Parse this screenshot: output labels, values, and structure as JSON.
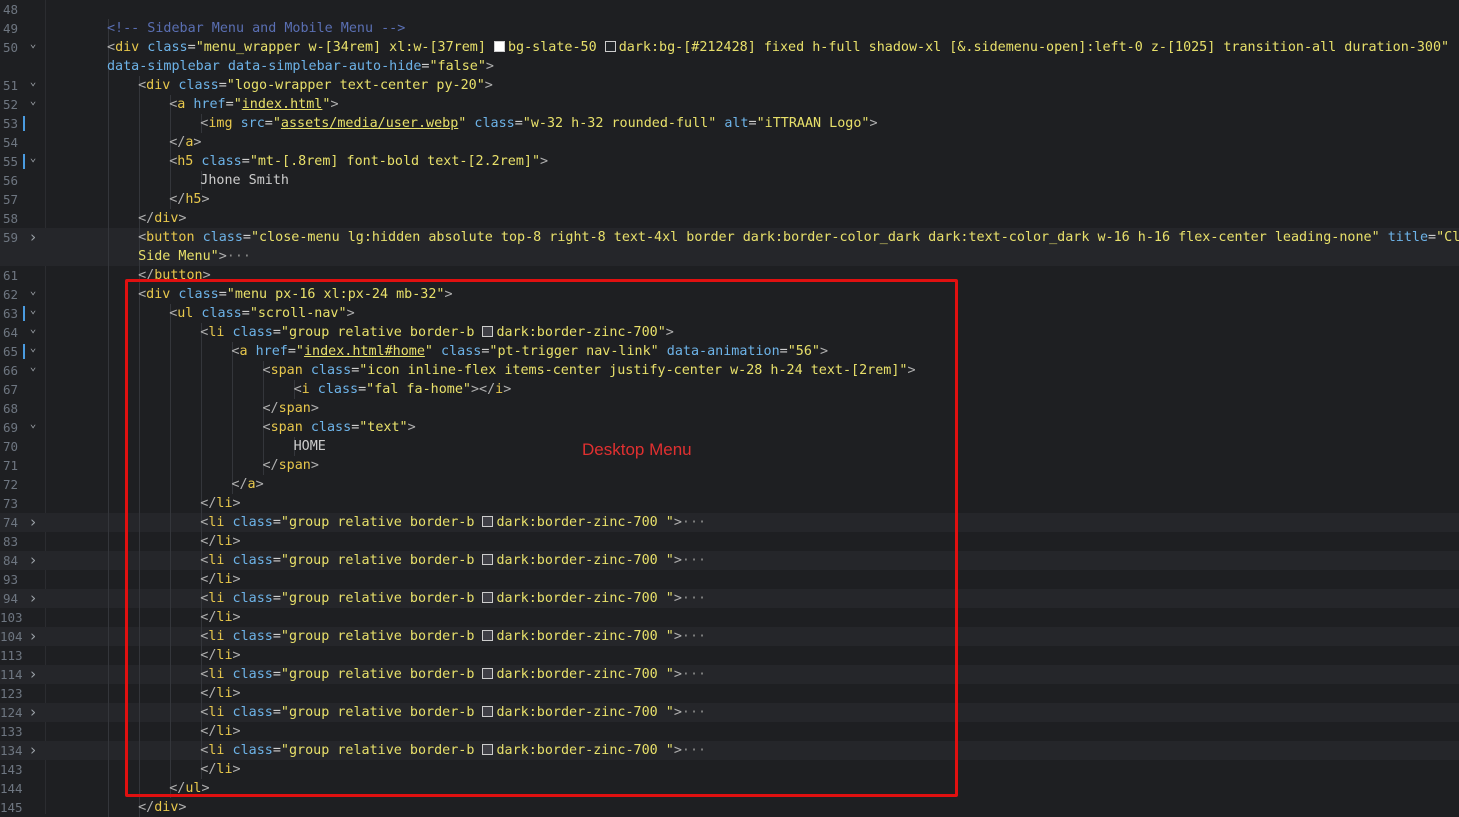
{
  "annotation": {
    "label": "Desktop Menu",
    "box_color": "#e01010"
  },
  "lines": [
    {
      "n": "48",
      "fold": "",
      "indent": 0,
      "segs": []
    },
    {
      "n": "49",
      "fold": "",
      "indent": 2,
      "segs": [
        [
          "c-cmt",
          "<!-- Sidebar Menu and Mobile Menu -->"
        ]
      ]
    },
    {
      "n": "50",
      "fold": "open",
      "indent": 2,
      "segs": [
        [
          "c-br",
          "<"
        ],
        [
          "c-tag",
          "div"
        ],
        [
          "c-attr",
          " class"
        ],
        [
          "c-eq",
          "="
        ],
        [
          "c-str",
          "\"menu_wrapper w-[34rem] xl:w-[37rem] "
        ],
        [
          "swatch",
          "#ffffff"
        ],
        [
          "c-str",
          "bg-slate-50 "
        ],
        [
          "swatch",
          "#212428"
        ],
        [
          "c-str",
          "dark:bg-[#212428] fixed h-full shadow-xl [&.sidemenu-open]:left-0 z-[1025] transition-all duration-300\""
        ]
      ]
    },
    {
      "n": "",
      "fold": "",
      "indent": 2,
      "segs": [
        [
          "c-attr",
          "data-simplebar data-simplebar-auto-hide"
        ],
        [
          "c-eq",
          "="
        ],
        [
          "c-str",
          "\"false\""
        ],
        [
          "c-br",
          ">"
        ]
      ]
    },
    {
      "n": "51",
      "fold": "open",
      "indent": 3,
      "segs": [
        [
          "c-br",
          "<"
        ],
        [
          "c-tag",
          "div"
        ],
        [
          "c-attr",
          " class"
        ],
        [
          "c-eq",
          "="
        ],
        [
          "c-str",
          "\"logo-wrapper text-center py-20\""
        ],
        [
          "c-br",
          ">"
        ]
      ]
    },
    {
      "n": "52",
      "fold": "open",
      "indent": 4,
      "segs": [
        [
          "c-br",
          "<"
        ],
        [
          "c-tag",
          "a"
        ],
        [
          "c-attr",
          " href"
        ],
        [
          "c-eq",
          "="
        ],
        [
          "c-str",
          "\""
        ],
        [
          "c-link",
          "index.html"
        ],
        [
          "c-str",
          "\""
        ],
        [
          "c-br",
          ">"
        ]
      ]
    },
    {
      "n": "53",
      "fold": "",
      "mod": true,
      "indent": 5,
      "segs": [
        [
          "c-br",
          "<"
        ],
        [
          "c-tag",
          "img"
        ],
        [
          "c-attr",
          " src"
        ],
        [
          "c-eq",
          "="
        ],
        [
          "c-str",
          "\""
        ],
        [
          "c-link",
          "assets/media/user.webp"
        ],
        [
          "c-str",
          "\""
        ],
        [
          "c-attr",
          " class"
        ],
        [
          "c-eq",
          "="
        ],
        [
          "c-str",
          "\"w-32 h-32 rounded-full\""
        ],
        [
          "c-attr",
          " alt"
        ],
        [
          "c-eq",
          "="
        ],
        [
          "c-str",
          "\"iTTRAAN Logo\""
        ],
        [
          "c-br",
          ">"
        ]
      ]
    },
    {
      "n": "54",
      "fold": "",
      "indent": 4,
      "segs": [
        [
          "c-br",
          "</"
        ],
        [
          "c-tag",
          "a"
        ],
        [
          "c-br",
          ">"
        ]
      ]
    },
    {
      "n": "55",
      "fold": "open",
      "mod": true,
      "indent": 4,
      "segs": [
        [
          "c-br",
          "<"
        ],
        [
          "c-tag",
          "h5"
        ],
        [
          "c-attr",
          " class"
        ],
        [
          "c-eq",
          "="
        ],
        [
          "c-str",
          "\"mt-[.8rem] font-bold text-[2.2rem]\""
        ],
        [
          "c-br",
          ">"
        ]
      ]
    },
    {
      "n": "56",
      "fold": "",
      "indent": 5,
      "segs": [
        [
          "c-txt",
          "Jhone Smith"
        ]
      ]
    },
    {
      "n": "57",
      "fold": "",
      "indent": 4,
      "segs": [
        [
          "c-br",
          "</"
        ],
        [
          "c-tag",
          "h5"
        ],
        [
          "c-br",
          ">"
        ]
      ]
    },
    {
      "n": "58",
      "fold": "",
      "indent": 3,
      "segs": [
        [
          "c-br",
          "</"
        ],
        [
          "c-tag",
          "div"
        ],
        [
          "c-br",
          ">"
        ]
      ]
    },
    {
      "n": "59",
      "fold": "closed",
      "hl": true,
      "indent": 3,
      "segs": [
        [
          "c-br",
          "<"
        ],
        [
          "c-tag",
          "button"
        ],
        [
          "c-attr",
          " class"
        ],
        [
          "c-eq",
          "="
        ],
        [
          "c-str",
          "\"close-menu lg:hidden absolute top-8 right-8 text-4xl border dark:border-color_dark dark:text-color_dark w-16 h-16 flex-center leading-none\""
        ],
        [
          "c-attr",
          " title"
        ],
        [
          "c-eq",
          "="
        ],
        [
          "c-str",
          "\"Close"
        ]
      ]
    },
    {
      "n": "",
      "fold": "",
      "hl": true,
      "indent": 3,
      "segs": [
        [
          "c-str",
          "Side Menu\""
        ],
        [
          "c-br",
          ">"
        ],
        [
          "c-ell",
          "···"
        ]
      ]
    },
    {
      "n": "61",
      "fold": "",
      "indent": 3,
      "segs": [
        [
          "c-br",
          "</"
        ],
        [
          "c-tag",
          "button"
        ],
        [
          "c-br",
          ">"
        ]
      ]
    },
    {
      "n": "62",
      "fold": "open",
      "indent": 3,
      "segs": [
        [
          "c-br",
          "<"
        ],
        [
          "c-tag",
          "div"
        ],
        [
          "c-attr",
          " class"
        ],
        [
          "c-eq",
          "="
        ],
        [
          "c-str",
          "\"menu px-16 xl:px-24 mb-32\""
        ],
        [
          "c-br",
          ">"
        ]
      ]
    },
    {
      "n": "63",
      "fold": "open",
      "mod": true,
      "indent": 4,
      "segs": [
        [
          "c-br",
          "<"
        ],
        [
          "c-tag",
          "ul"
        ],
        [
          "c-attr",
          " class"
        ],
        [
          "c-eq",
          "="
        ],
        [
          "c-str",
          "\"scroll-nav\""
        ],
        [
          "c-br",
          ">"
        ]
      ]
    },
    {
      "n": "64",
      "fold": "open",
      "indent": 5,
      "segs": [
        [
          "c-br",
          "<"
        ],
        [
          "c-tag",
          "li"
        ],
        [
          "c-attr",
          " class"
        ],
        [
          "c-eq",
          "="
        ],
        [
          "c-str",
          "\"group relative border-b "
        ],
        [
          "swatch",
          "#3f3f46"
        ],
        [
          "c-str",
          "dark:border-zinc-700\""
        ],
        [
          "c-br",
          ">"
        ]
      ]
    },
    {
      "n": "65",
      "fold": "open",
      "mod": true,
      "indent": 6,
      "segs": [
        [
          "c-br",
          "<"
        ],
        [
          "c-tag",
          "a"
        ],
        [
          "c-attr",
          " href"
        ],
        [
          "c-eq",
          "="
        ],
        [
          "c-str",
          "\""
        ],
        [
          "c-link",
          "index.html#home"
        ],
        [
          "c-str",
          "\""
        ],
        [
          "c-attr",
          " class"
        ],
        [
          "c-eq",
          "="
        ],
        [
          "c-str",
          "\"pt-trigger nav-link\""
        ],
        [
          "c-attr",
          " data-animation"
        ],
        [
          "c-eq",
          "="
        ],
        [
          "c-str",
          "\"56\""
        ],
        [
          "c-br",
          ">"
        ]
      ]
    },
    {
      "n": "66",
      "fold": "open",
      "indent": 7,
      "segs": [
        [
          "c-br",
          "<"
        ],
        [
          "c-tag",
          "span"
        ],
        [
          "c-attr",
          " class"
        ],
        [
          "c-eq",
          "="
        ],
        [
          "c-str",
          "\"icon inline-flex items-center justify-center w-28 h-24 text-[2rem]\""
        ],
        [
          "c-br",
          ">"
        ]
      ]
    },
    {
      "n": "67",
      "fold": "",
      "indent": 8,
      "segs": [
        [
          "c-br",
          "<"
        ],
        [
          "c-tag",
          "i"
        ],
        [
          "c-attr",
          " class"
        ],
        [
          "c-eq",
          "="
        ],
        [
          "c-str",
          "\"fal fa-home\""
        ],
        [
          "c-br",
          "></"
        ],
        [
          "c-tag",
          "i"
        ],
        [
          "c-br",
          ">"
        ]
      ]
    },
    {
      "n": "68",
      "fold": "",
      "indent": 7,
      "segs": [
        [
          "c-br",
          "</"
        ],
        [
          "c-tag",
          "span"
        ],
        [
          "c-br",
          ">"
        ]
      ]
    },
    {
      "n": "69",
      "fold": "open",
      "indent": 7,
      "segs": [
        [
          "c-br",
          "<"
        ],
        [
          "c-tag",
          "span"
        ],
        [
          "c-attr",
          " class"
        ],
        [
          "c-eq",
          "="
        ],
        [
          "c-str",
          "\"text\""
        ],
        [
          "c-br",
          ">"
        ]
      ]
    },
    {
      "n": "70",
      "fold": "",
      "indent": 8,
      "segs": [
        [
          "c-txt",
          "HOME"
        ]
      ]
    },
    {
      "n": "71",
      "fold": "",
      "indent": 7,
      "segs": [
        [
          "c-br",
          "</"
        ],
        [
          "c-tag",
          "span"
        ],
        [
          "c-br",
          ">"
        ]
      ]
    },
    {
      "n": "72",
      "fold": "",
      "indent": 6,
      "segs": [
        [
          "c-br",
          "</"
        ],
        [
          "c-tag",
          "a"
        ],
        [
          "c-br",
          ">"
        ]
      ]
    },
    {
      "n": "73",
      "fold": "",
      "indent": 5,
      "segs": [
        [
          "c-br",
          "</"
        ],
        [
          "c-tag",
          "li"
        ],
        [
          "c-br",
          ">"
        ]
      ]
    },
    {
      "n": "74",
      "fold": "closed",
      "hl": true,
      "indent": 5,
      "segs": [
        [
          "c-br",
          "<"
        ],
        [
          "c-tag",
          "li"
        ],
        [
          "c-attr",
          " class"
        ],
        [
          "c-eq",
          "="
        ],
        [
          "c-str",
          "\"group relative border-b "
        ],
        [
          "swatch",
          "#3f3f46"
        ],
        [
          "c-str",
          "dark:border-zinc-700 \""
        ],
        [
          "c-br",
          ">"
        ],
        [
          "c-ell",
          "···"
        ]
      ]
    },
    {
      "n": "83",
      "fold": "",
      "indent": 5,
      "segs": [
        [
          "c-br",
          "</"
        ],
        [
          "c-tag",
          "li"
        ],
        [
          "c-br",
          ">"
        ]
      ]
    },
    {
      "n": "84",
      "fold": "closed",
      "hl": true,
      "indent": 5,
      "segs": [
        [
          "c-br",
          "<"
        ],
        [
          "c-tag",
          "li"
        ],
        [
          "c-attr",
          " class"
        ],
        [
          "c-eq",
          "="
        ],
        [
          "c-str",
          "\"group relative border-b "
        ],
        [
          "swatch",
          "#3f3f46"
        ],
        [
          "c-str",
          "dark:border-zinc-700 \""
        ],
        [
          "c-br",
          ">"
        ],
        [
          "c-ell",
          "···"
        ]
      ]
    },
    {
      "n": "93",
      "fold": "",
      "indent": 5,
      "segs": [
        [
          "c-br",
          "</"
        ],
        [
          "c-tag",
          "li"
        ],
        [
          "c-br",
          ">"
        ]
      ]
    },
    {
      "n": "94",
      "fold": "closed",
      "hl": true,
      "indent": 5,
      "segs": [
        [
          "c-br",
          "<"
        ],
        [
          "c-tag",
          "li"
        ],
        [
          "c-attr",
          " class"
        ],
        [
          "c-eq",
          "="
        ],
        [
          "c-str",
          "\"group relative border-b "
        ],
        [
          "swatch",
          "#3f3f46"
        ],
        [
          "c-str",
          "dark:border-zinc-700 \""
        ],
        [
          "c-br",
          ">"
        ],
        [
          "c-ell",
          "···"
        ]
      ]
    },
    {
      "n": "103",
      "fold": "",
      "indent": 5,
      "segs": [
        [
          "c-br",
          "</"
        ],
        [
          "c-tag",
          "li"
        ],
        [
          "c-br",
          ">"
        ]
      ]
    },
    {
      "n": "104",
      "fold": "closed",
      "hl": true,
      "indent": 5,
      "segs": [
        [
          "c-br",
          "<"
        ],
        [
          "c-tag",
          "li"
        ],
        [
          "c-attr",
          " class"
        ],
        [
          "c-eq",
          "="
        ],
        [
          "c-str",
          "\"group relative border-b "
        ],
        [
          "swatch",
          "#3f3f46"
        ],
        [
          "c-str",
          "dark:border-zinc-700 \""
        ],
        [
          "c-br",
          ">"
        ],
        [
          "c-ell",
          "···"
        ]
      ]
    },
    {
      "n": "113",
      "fold": "",
      "indent": 5,
      "segs": [
        [
          "c-br",
          "</"
        ],
        [
          "c-tag",
          "li"
        ],
        [
          "c-br",
          ">"
        ]
      ]
    },
    {
      "n": "114",
      "fold": "closed",
      "hl": true,
      "indent": 5,
      "segs": [
        [
          "c-br",
          "<"
        ],
        [
          "c-tag",
          "li"
        ],
        [
          "c-attr",
          " class"
        ],
        [
          "c-eq",
          "="
        ],
        [
          "c-str",
          "\"group relative border-b "
        ],
        [
          "swatch",
          "#3f3f46"
        ],
        [
          "c-str",
          "dark:border-zinc-700 \""
        ],
        [
          "c-br",
          ">"
        ],
        [
          "c-ell",
          "···"
        ]
      ]
    },
    {
      "n": "123",
      "fold": "",
      "indent": 5,
      "segs": [
        [
          "c-br",
          "</"
        ],
        [
          "c-tag",
          "li"
        ],
        [
          "c-br",
          ">"
        ]
      ]
    },
    {
      "n": "124",
      "fold": "closed",
      "hl": true,
      "indent": 5,
      "segs": [
        [
          "c-br",
          "<"
        ],
        [
          "c-tag",
          "li"
        ],
        [
          "c-attr",
          " class"
        ],
        [
          "c-eq",
          "="
        ],
        [
          "c-str",
          "\"group relative border-b "
        ],
        [
          "swatch",
          "#3f3f46"
        ],
        [
          "c-str",
          "dark:border-zinc-700 \""
        ],
        [
          "c-br",
          ">"
        ],
        [
          "c-ell",
          "···"
        ]
      ]
    },
    {
      "n": "133",
      "fold": "",
      "indent": 5,
      "segs": [
        [
          "c-br",
          "</"
        ],
        [
          "c-tag",
          "li"
        ],
        [
          "c-br",
          ">"
        ]
      ]
    },
    {
      "n": "134",
      "fold": "closed",
      "hl": true,
      "indent": 5,
      "segs": [
        [
          "c-br",
          "<"
        ],
        [
          "c-tag",
          "li"
        ],
        [
          "c-attr",
          " class"
        ],
        [
          "c-eq",
          "="
        ],
        [
          "c-str",
          "\"group relative border-b "
        ],
        [
          "swatch",
          "#3f3f46"
        ],
        [
          "c-str",
          "dark:border-zinc-700 \""
        ],
        [
          "c-br",
          ">"
        ],
        [
          "c-ell",
          "···"
        ]
      ]
    },
    {
      "n": "143",
      "fold": "",
      "indent": 5,
      "segs": [
        [
          "c-br",
          "</"
        ],
        [
          "c-tag",
          "li"
        ],
        [
          "c-br",
          ">"
        ]
      ]
    },
    {
      "n": "144",
      "fold": "",
      "indent": 4,
      "segs": [
        [
          "c-br",
          "</"
        ],
        [
          "c-tag",
          "ul"
        ],
        [
          "c-br",
          ">"
        ]
      ]
    },
    {
      "n": "145",
      "fold": "",
      "indent": 3,
      "segs": [
        [
          "c-br",
          "</"
        ],
        [
          "c-tag",
          "div"
        ],
        [
          "c-br",
          ">"
        ]
      ]
    }
  ]
}
